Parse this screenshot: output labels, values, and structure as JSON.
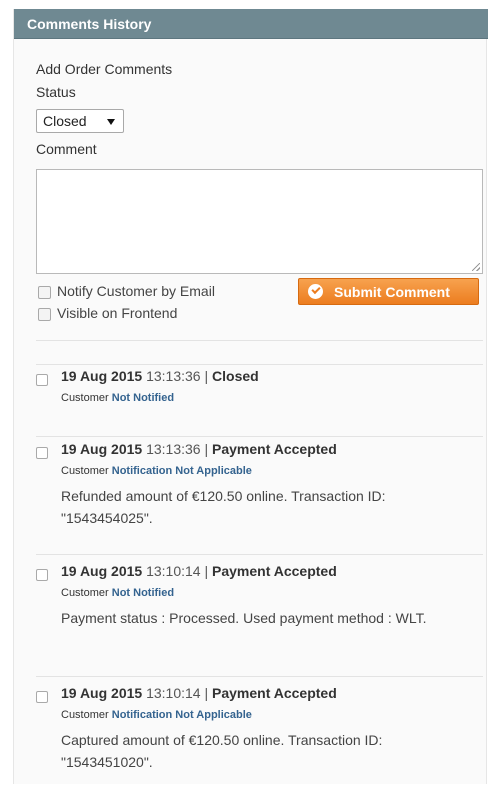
{
  "header": {
    "title": "Comments History"
  },
  "form": {
    "section_label": "Add Order Comments",
    "status_label": "Status",
    "status_value": "Closed",
    "comment_label": "Comment",
    "comment_value": "",
    "notify_label": "Notify Customer by Email",
    "notify_checked": false,
    "visible_label": "Visible on Frontend",
    "visible_checked": false,
    "submit_label": "Submit Comment"
  },
  "colors": {
    "header_bg": "#6f8992",
    "submit_bg": "#ec7d1f",
    "notify_text": "#34638f"
  },
  "history": [
    {
      "date": "19 Aug 2015",
      "time": "13:13:36",
      "separator": "|",
      "status": "Closed",
      "customer_label": "Customer",
      "notification": "Not Notified",
      "message": ""
    },
    {
      "date": "19 Aug 2015",
      "time": "13:13:36",
      "separator": "|",
      "status": "Payment Accepted",
      "customer_label": "Customer",
      "notification": "Notification Not Applicable",
      "message": "Refunded amount of €120.50 online. Transaction ID: \"1543454025\"."
    },
    {
      "date": "19 Aug 2015",
      "time": "13:10:14",
      "separator": "|",
      "status": "Payment Accepted",
      "customer_label": "Customer",
      "notification": "Not Notified",
      "message": "Payment status : Processed. Used payment method : WLT."
    },
    {
      "date": "19 Aug 2015",
      "time": "13:10:14",
      "separator": "|",
      "status": "Payment Accepted",
      "customer_label": "Customer",
      "notification": "Notification Not Applicable",
      "message": "Captured amount of €120.50 online. Transaction ID: \"1543451020\"."
    }
  ]
}
